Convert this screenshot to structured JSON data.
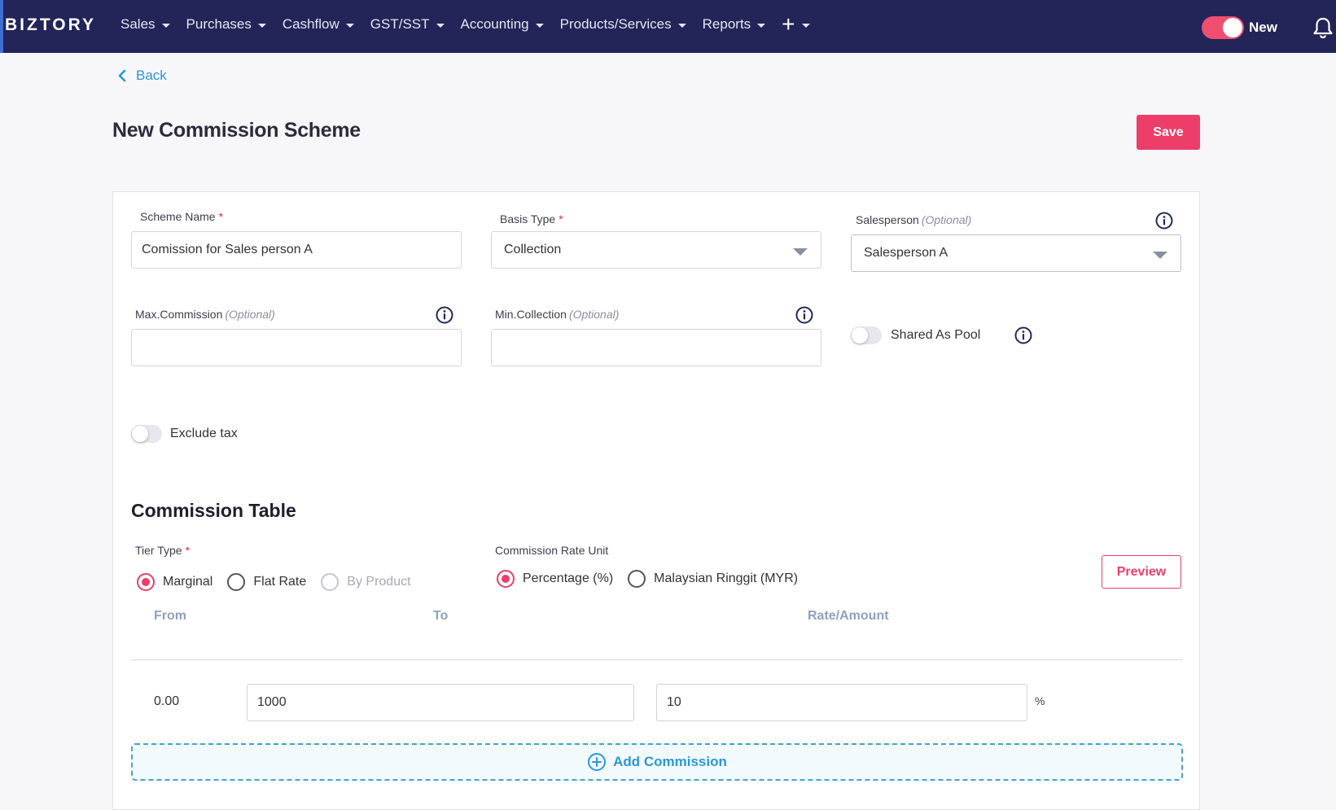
{
  "app": {
    "logo": "BIZTORY"
  },
  "nav": {
    "items": [
      "Sales",
      "Purchases",
      "Cashflow",
      "GST/SST",
      "Accounting",
      "Products/Services",
      "Reports"
    ],
    "plus": "+",
    "new_toggle_label": "New",
    "new_toggle_on": true
  },
  "page": {
    "back_label": "Back",
    "title": "New Commission Scheme",
    "save_label": "Save"
  },
  "form": {
    "scheme_name": {
      "label": "Scheme Name",
      "required": "*",
      "value": "Comission for Sales person A"
    },
    "basis_type": {
      "label": "Basis Type",
      "required": "*",
      "value": "Collection"
    },
    "salesperson": {
      "label": "Salesperson",
      "optional": "(Optional)",
      "value": "Salesperson A"
    },
    "max_commission": {
      "label": "Max.Commission",
      "optional": "(Optional)",
      "value": ""
    },
    "min_collection": {
      "label": "Min.Collection",
      "optional": "(Optional)",
      "value": ""
    },
    "shared_as_pool": {
      "label": "Shared As Pool",
      "on": false
    },
    "exclude_tax": {
      "label": "Exclude tax",
      "on": false
    }
  },
  "commission_table": {
    "title": "Commission Table",
    "tier_type": {
      "label": "Tier Type",
      "required": "*",
      "options": [
        "Marginal",
        "Flat Rate",
        "By Product"
      ],
      "selected": "Marginal"
    },
    "rate_unit": {
      "label": "Commission Rate Unit",
      "options": [
        "Percentage (%)",
        "Malaysian Ringgit (MYR)"
      ],
      "selected": "Percentage (%)"
    },
    "preview_label": "Preview",
    "columns": [
      "From",
      "To",
      "Rate/Amount"
    ],
    "rows": [
      {
        "from": "0.00",
        "to": "1000",
        "rate": "10",
        "unit": "%"
      }
    ],
    "add_label": "Add Commission"
  },
  "colors": {
    "nav_bg": "#232458",
    "accent": "#ed3e69",
    "link": "#2b97d6"
  }
}
